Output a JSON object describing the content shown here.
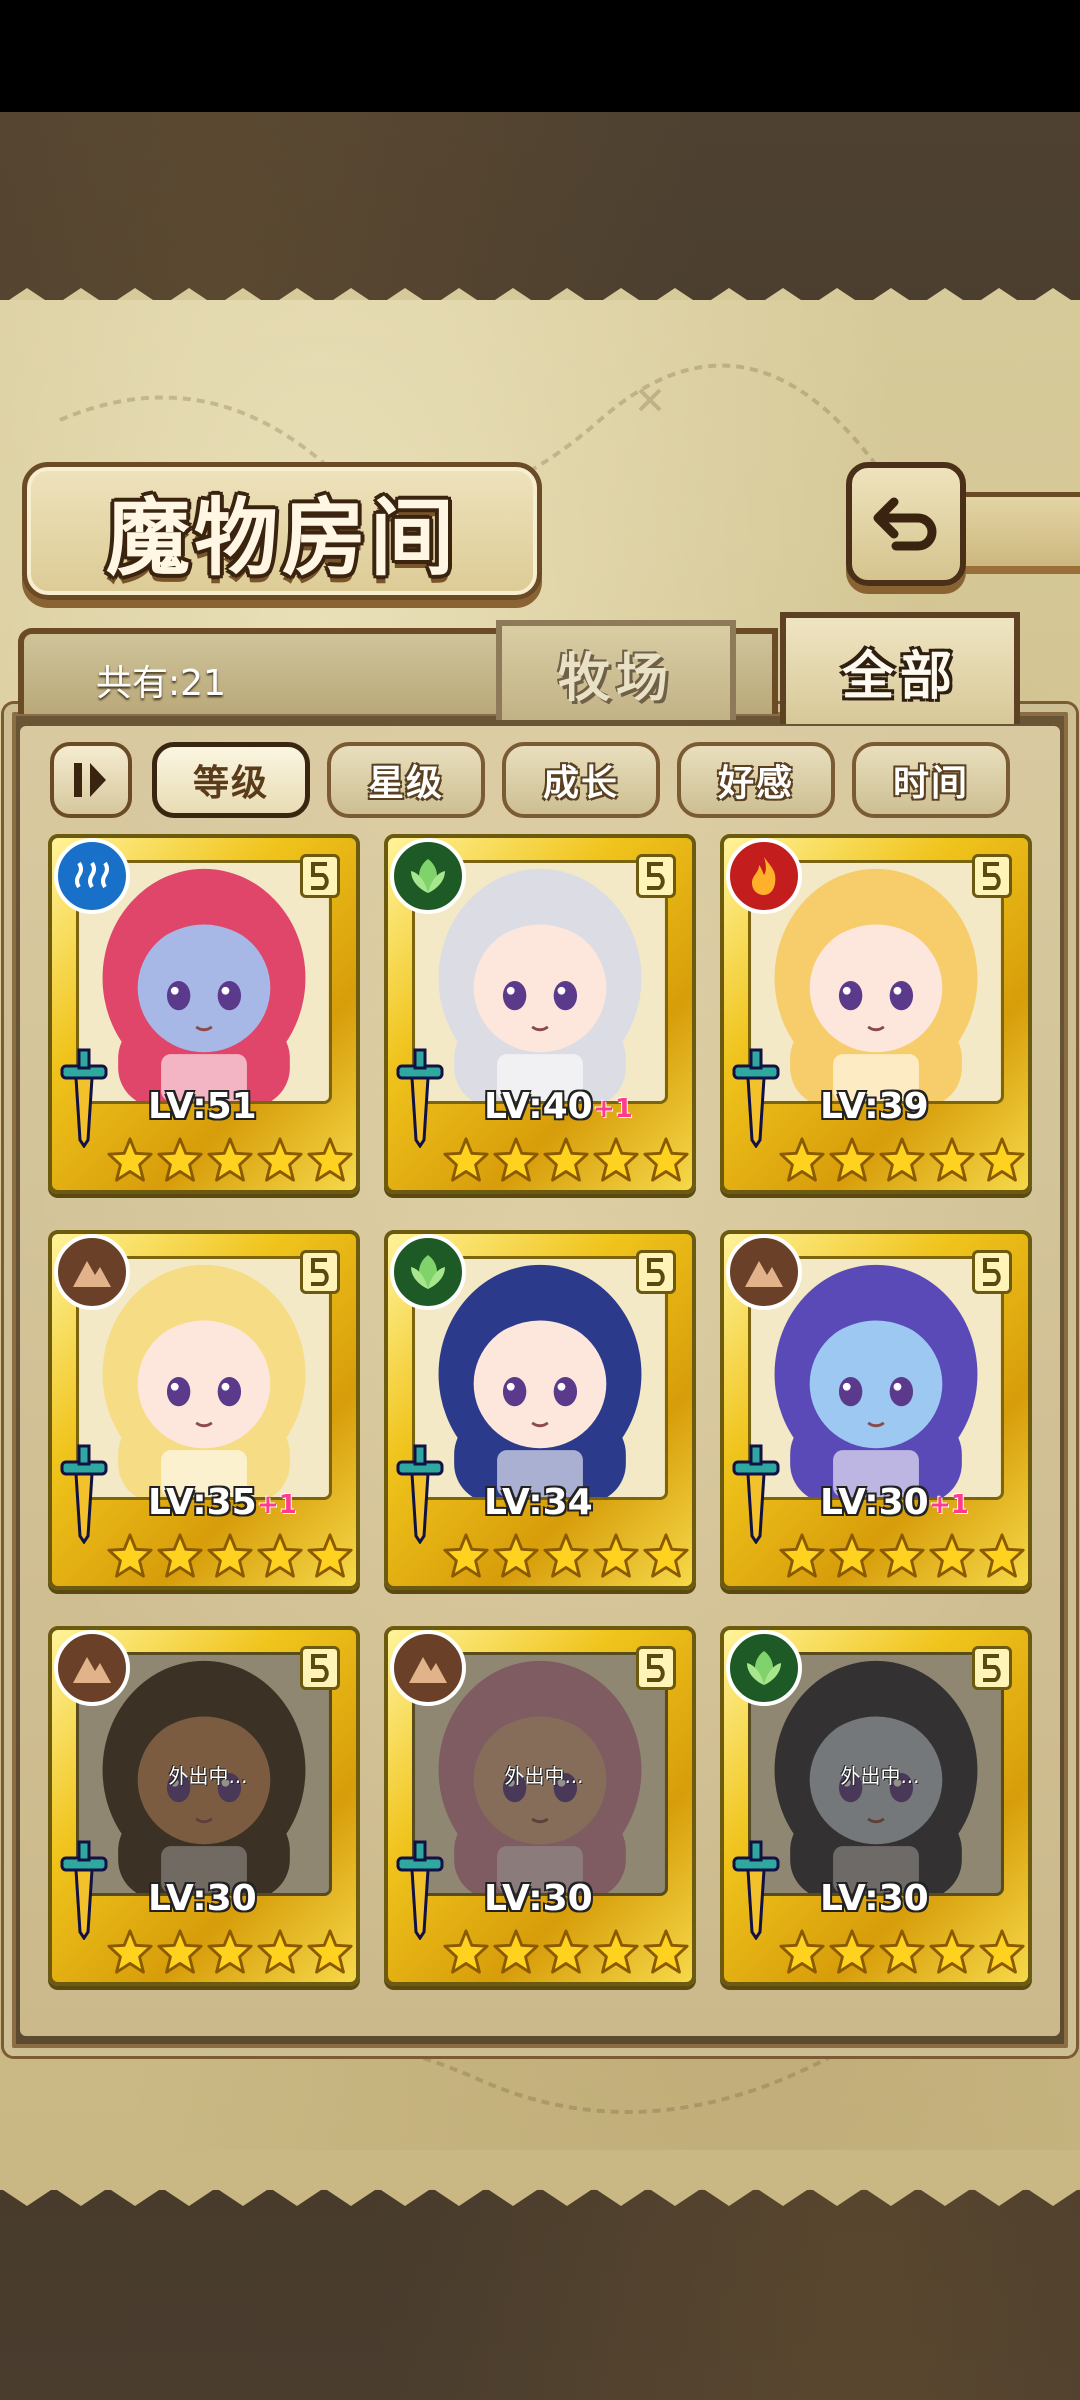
{
  "screen": {
    "title": "魔物房间",
    "total_label": "共有:21",
    "tabs": [
      {
        "label": "牧场",
        "active": false
      },
      {
        "label": "全部",
        "active": true
      }
    ],
    "sort_buttons": [
      {
        "label": "等级",
        "active": true
      },
      {
        "label": "星级",
        "active": false
      },
      {
        "label": "成长",
        "active": false
      },
      {
        "label": "好感",
        "active": false
      },
      {
        "label": "时间",
        "active": false
      }
    ]
  },
  "monsters": [
    {
      "element": "water",
      "level_label": "LV:51",
      "plus": "",
      "stars": 5,
      "away": false,
      "away_label": "",
      "hair": "#e0456a",
      "skin": "#a8b8e6"
    },
    {
      "element": "nature",
      "level_label": "LV:40",
      "plus": "+1",
      "stars": 5,
      "away": false,
      "away_label": "",
      "hair": "#dcdce4",
      "skin": "#fde7dc"
    },
    {
      "element": "fire",
      "level_label": "LV:39",
      "plus": "",
      "stars": 5,
      "away": false,
      "away_label": "",
      "hair": "#f7cc6a",
      "skin": "#fde7dc"
    },
    {
      "element": "earth",
      "level_label": "LV:35",
      "plus": "+1",
      "stars": 5,
      "away": false,
      "away_label": "",
      "hair": "#f7dc86",
      "skin": "#fde7dc"
    },
    {
      "element": "nature",
      "level_label": "LV:34",
      "plus": "",
      "stars": 5,
      "away": false,
      "away_label": "",
      "hair": "#2c3a8c",
      "skin": "#fde7dc"
    },
    {
      "element": "earth",
      "level_label": "LV:30",
      "plus": "+1",
      "stars": 5,
      "away": false,
      "away_label": "",
      "hair": "#5a4ab8",
      "skin": "#9cc8f2"
    },
    {
      "element": "earth",
      "level_label": "LV:30",
      "plus": "",
      "stars": 5,
      "away": true,
      "away_label": "外出中...",
      "hair": "#3a2a1a",
      "skin": "#c88a5a"
    },
    {
      "element": "earth",
      "level_label": "LV:30",
      "plus": "",
      "stars": 5,
      "away": true,
      "away_label": "外出中...",
      "hair": "#d08aa0",
      "skin": "#e0b090"
    },
    {
      "element": "nature",
      "level_label": "LV:30",
      "plus": "",
      "stars": 5,
      "away": true,
      "away_label": "外出中...",
      "hair": "#2a2a3a",
      "skin": "#b8c8d8"
    }
  ]
}
